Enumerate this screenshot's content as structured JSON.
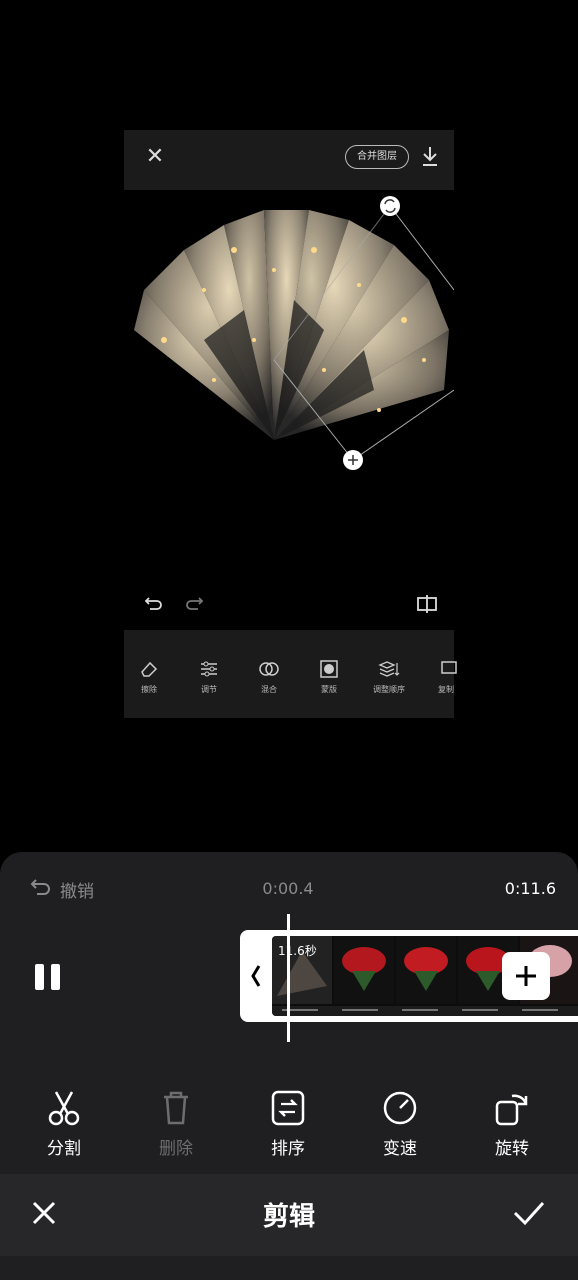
{
  "preview": {
    "merge_layers_label": "合并图层",
    "tools": [
      {
        "label": "擦除",
        "icon": "eraser-icon"
      },
      {
        "label": "调节",
        "icon": "adjust-sliders-icon"
      },
      {
        "label": "混合",
        "icon": "blend-icon"
      },
      {
        "label": "蒙版",
        "icon": "mask-icon"
      },
      {
        "label": "调整顺序",
        "icon": "layer-order-icon"
      },
      {
        "label": "复制",
        "icon": "copy-icon"
      }
    ]
  },
  "editor": {
    "undo_label": "撤销",
    "current_time": "0:00.4",
    "total_time": "0:11.6",
    "clip_duration": "11.6秒",
    "actions": [
      {
        "label": "分割",
        "icon": "scissors-icon",
        "enabled": true
      },
      {
        "label": "删除",
        "icon": "trash-icon",
        "enabled": false
      },
      {
        "label": "排序",
        "icon": "sort-icon",
        "enabled": true
      },
      {
        "label": "变速",
        "icon": "speed-icon",
        "enabled": true
      },
      {
        "label": "旋转",
        "icon": "rotate-icon",
        "enabled": true
      }
    ],
    "title": "剪辑"
  },
  "colors": {
    "panel_bg": "#1f1f21",
    "bar_bg": "#27272a",
    "disabled_text": "#6d6d6d"
  }
}
